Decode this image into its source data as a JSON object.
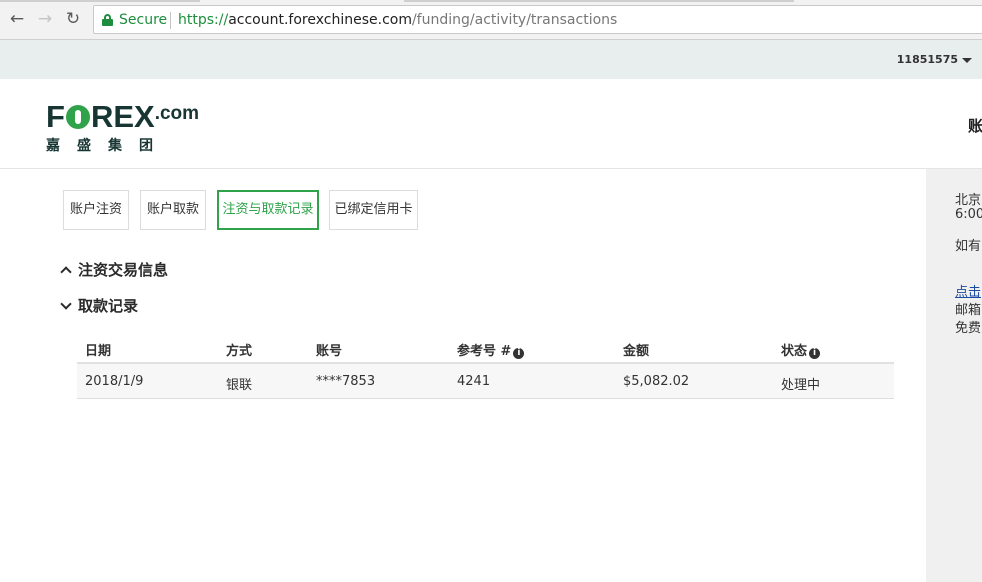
{
  "browser": {
    "secure_label": "Secure",
    "url_scheme": "https://",
    "url_host": "account.forexchinese.com",
    "url_path": "/funding/activity/transactions",
    "back_icon": "arrow-left-icon",
    "forward_icon": "arrow-right-icon",
    "reload_icon": "reload-icon"
  },
  "account": {
    "id": "11851575"
  },
  "header": {
    "logo_prefix": "F",
    "logo_suffix": "REX",
    "logo_domain": ".com",
    "logo_cn": "嘉盛集团",
    "right_text": "账"
  },
  "tabs": [
    {
      "label": "账户注资",
      "active": false
    },
    {
      "label": "账户取款",
      "active": false
    },
    {
      "label": "注资与取款记录",
      "active": true
    },
    {
      "label": "已绑定信用卡",
      "active": false
    }
  ],
  "sections": {
    "deposit_info": "注资交易信息",
    "withdrawal_records": "取款记录"
  },
  "table": {
    "headers": [
      "日期",
      "方式",
      "账号",
      "参考号 #",
      "金额",
      "状态"
    ],
    "rows": [
      [
        "2018/1/9",
        "银联",
        "****7853",
        "4241",
        "$5,082.02",
        "处理中"
      ]
    ]
  },
  "sidebar": {
    "lines": [
      "北京",
      "6:00",
      "如有",
      "点击",
      "邮箱",
      "免费"
    ]
  },
  "colors": {
    "accent": "#2fa24a",
    "brand_dark": "#173633",
    "account_strip": "#e8eeed",
    "secure_green": "#1e8e3e"
  }
}
